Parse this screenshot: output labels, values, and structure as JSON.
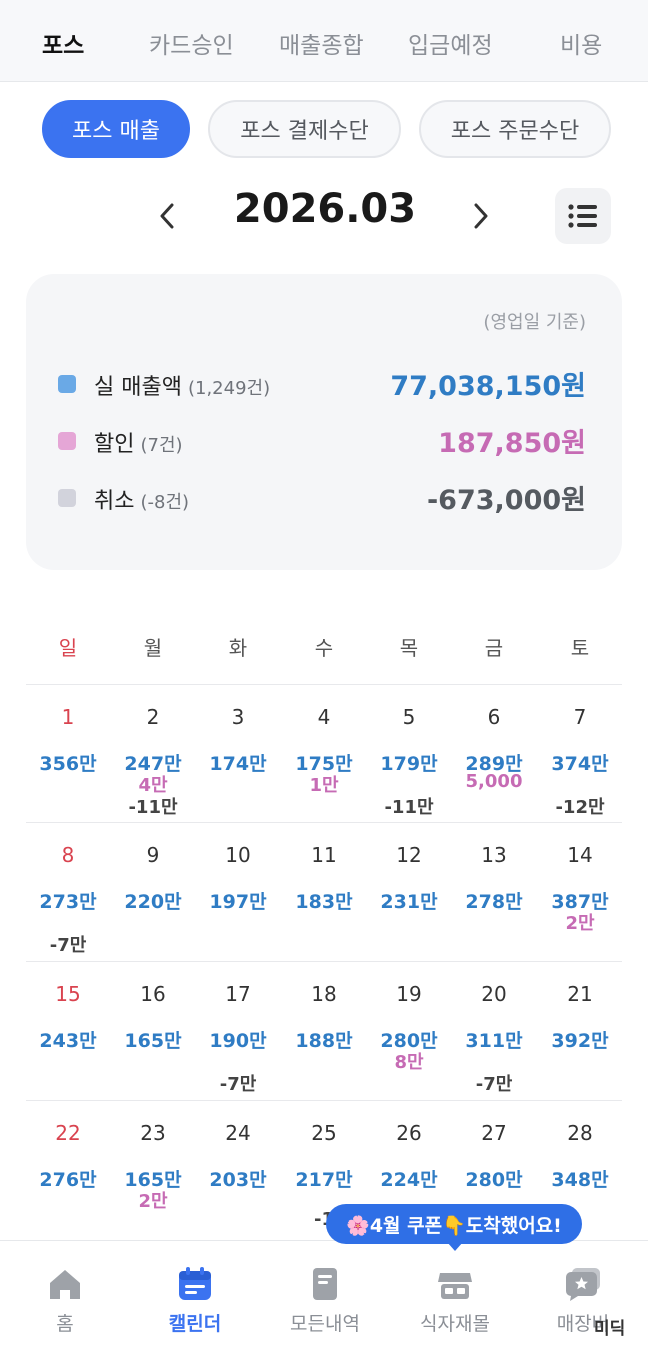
{
  "top_tabs": [
    "포스",
    "카드승인",
    "매출종합",
    "입금예정",
    "비용"
  ],
  "sub_tabs": [
    "포스 매출",
    "포스 결제수단",
    "포스 주문수단"
  ],
  "month": "2026.03",
  "summary": {
    "basis": "(영업일 기준)",
    "rows": [
      {
        "label": "실 매출액",
        "count": "(1,249건)",
        "amount": "77,038,150원",
        "color": "#2f7cc4",
        "marker": "#6aa9e6"
      },
      {
        "label": "할인",
        "count": "(7건)",
        "amount": "187,850원",
        "color": "#c66bb4",
        "marker": "#e5a6d6"
      },
      {
        "label": "취소",
        "count": "(-8건)",
        "amount": "-673,000원",
        "color": "#555a60",
        "marker": "#d2d3dc"
      }
    ]
  },
  "weekdays": [
    "일",
    "월",
    "화",
    "수",
    "목",
    "금",
    "토"
  ],
  "weeks": [
    [
      {
        "day": "1",
        "sales": "356만",
        "disc": "",
        "canc": ""
      },
      {
        "day": "2",
        "sales": "247만",
        "disc": "4만",
        "canc": "-11만"
      },
      {
        "day": "3",
        "sales": "174만",
        "disc": "",
        "canc": ""
      },
      {
        "day": "4",
        "sales": "175만",
        "disc": "1만",
        "canc": ""
      },
      {
        "day": "5",
        "sales": "179만",
        "disc": "",
        "canc": "-11만"
      },
      {
        "day": "6",
        "sales": "289만",
        "disc": "5,000",
        "canc": ""
      },
      {
        "day": "7",
        "sales": "374만",
        "disc": "",
        "canc": "-12만"
      }
    ],
    [
      {
        "day": "8",
        "sales": "273만",
        "disc": "",
        "canc": "-7만"
      },
      {
        "day": "9",
        "sales": "220만",
        "disc": "",
        "canc": ""
      },
      {
        "day": "10",
        "sales": "197만",
        "disc": "",
        "canc": ""
      },
      {
        "day": "11",
        "sales": "183만",
        "disc": "",
        "canc": ""
      },
      {
        "day": "12",
        "sales": "231만",
        "disc": "",
        "canc": ""
      },
      {
        "day": "13",
        "sales": "278만",
        "disc": "",
        "canc": ""
      },
      {
        "day": "14",
        "sales": "387만",
        "disc": "2만",
        "canc": ""
      }
    ],
    [
      {
        "day": "15",
        "sales": "243만",
        "disc": "",
        "canc": ""
      },
      {
        "day": "16",
        "sales": "165만",
        "disc": "",
        "canc": ""
      },
      {
        "day": "17",
        "sales": "190만",
        "disc": "",
        "canc": "-7만"
      },
      {
        "day": "18",
        "sales": "188만",
        "disc": "",
        "canc": ""
      },
      {
        "day": "19",
        "sales": "280만",
        "disc": "8만",
        "canc": ""
      },
      {
        "day": "20",
        "sales": "311만",
        "disc": "",
        "canc": "-7만"
      },
      {
        "day": "21",
        "sales": "392만",
        "disc": "",
        "canc": ""
      }
    ],
    [
      {
        "day": "22",
        "sales": "276만",
        "disc": "",
        "canc": ""
      },
      {
        "day": "23",
        "sales": "165만",
        "disc": "2만",
        "canc": ""
      },
      {
        "day": "24",
        "sales": "203만",
        "disc": "",
        "canc": ""
      },
      {
        "day": "25",
        "sales": "217만",
        "disc": "",
        "canc": "-1"
      },
      {
        "day": "26",
        "sales": "224만",
        "disc": "",
        "canc": ""
      },
      {
        "day": "27",
        "sales": "280만",
        "disc": "",
        "canc": ""
      },
      {
        "day": "28",
        "sales": "348만",
        "disc": "",
        "canc": ""
      }
    ]
  ],
  "coupon_banner": "🌸4월 쿠폰👇도착했어요!",
  "bottom_nav": [
    "홈",
    "캘린더",
    "모든내역",
    "식자재몰",
    "매장버"
  ],
  "watermark": "미딕",
  "colors": {
    "accent": "#3b73f0",
    "sales": "#2f7cc4",
    "discount": "#c66bb4",
    "sunday": "#d9434f"
  }
}
